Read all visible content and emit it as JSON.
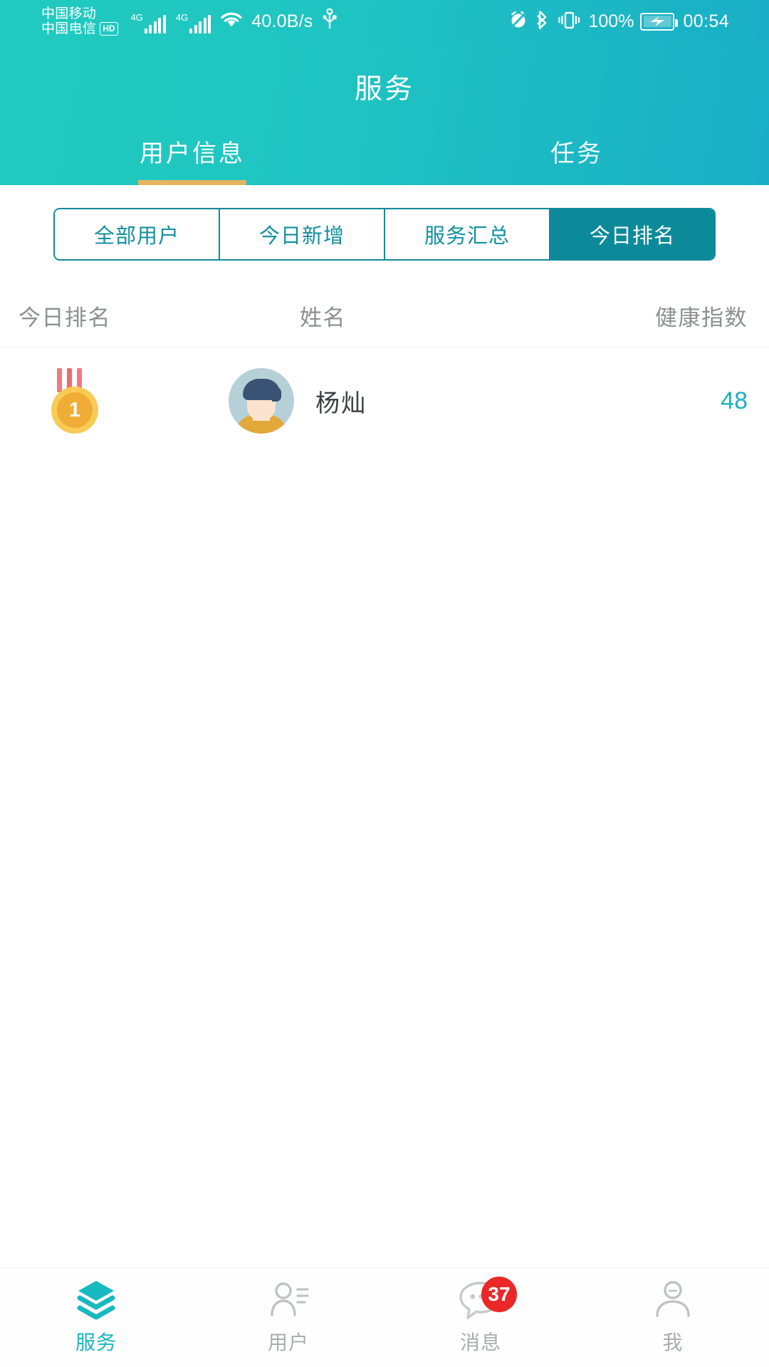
{
  "statusbar": {
    "carrier_primary": "中国移动",
    "carrier_secondary": "中国电信",
    "hd_badge": "HD",
    "network_type_1": "4G",
    "network_type_2": "4G",
    "icons": [
      "signal-bars-icon",
      "signal-bars-icon",
      "wifi-icon",
      "usb-icon",
      "alarm-muted-icon",
      "bluetooth-icon",
      "vibrate-icon",
      "battery-charging-icon"
    ],
    "net_speed": "40.0B/s",
    "battery_percent": "100%",
    "clock": "00:54"
  },
  "header": {
    "title": "服务",
    "accent_gradient_from": "#21cbbf",
    "accent_gradient_to": "#19aec6",
    "underline_color": "#e8b45f",
    "tabs": [
      {
        "label": "用户信息",
        "active": true
      },
      {
        "label": "任务",
        "active": false
      }
    ]
  },
  "segmented": {
    "active_color": "#0d8a99",
    "items": [
      {
        "label": "全部用户",
        "active": false
      },
      {
        "label": "今日新增",
        "active": false
      },
      {
        "label": "服务汇总",
        "active": false
      },
      {
        "label": "今日排名",
        "active": true
      }
    ]
  },
  "table": {
    "headers": {
      "rank": "今日排名",
      "name": "姓名",
      "score": "健康指数"
    },
    "rows": [
      {
        "rank": "1",
        "rank_icon": "gold-medal-icon",
        "avatar_icon": "user-avatar-icon",
        "name": "杨灿",
        "score": "48",
        "score_color": "#18b3bd"
      }
    ]
  },
  "bottomnav": {
    "active_color": "#19b6bd",
    "inactive_color": "#a9adaf",
    "badge_color": "#ea2828",
    "items": [
      {
        "label": "服务",
        "icon": "layers-icon",
        "active": true,
        "badge": ""
      },
      {
        "label": "用户",
        "icon": "user-list-icon",
        "active": false,
        "badge": ""
      },
      {
        "label": "消息",
        "icon": "chat-bubble-icon",
        "active": false,
        "badge": "37"
      },
      {
        "label": "我",
        "icon": "person-icon",
        "active": false,
        "badge": ""
      }
    ]
  }
}
